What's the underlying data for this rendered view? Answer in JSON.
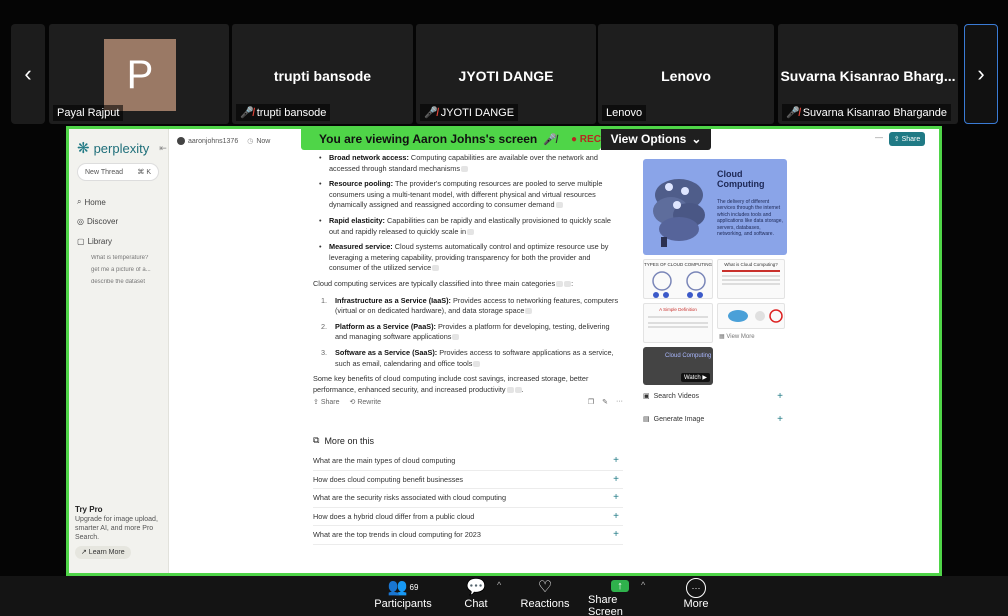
{
  "participants": [
    {
      "name": "Payal Rajput",
      "initial": "P",
      "label": "Payal Rajput",
      "muted": false
    },
    {
      "name": "trupti bansode",
      "label": "trupti bansode",
      "muted": true
    },
    {
      "name": "JYOTI DANGE",
      "label": "JYOTI DANGE",
      "muted": true
    },
    {
      "name": "Lenovo",
      "label": "Lenovo",
      "muted": false
    },
    {
      "name": "Suvarna Kisanrao Bharg...",
      "label": "Suvarna Kisanrao Bhargande",
      "muted": true
    }
  ],
  "nav": {
    "prev": "‹",
    "next": "›"
  },
  "share_banner": {
    "text": "You are viewing  Aaron Johns's screen",
    "rec": "REC",
    "view_options": "View Options"
  },
  "perplexity": {
    "logo": "perplexity",
    "new_thread": "New Thread",
    "shortcut": "⌘ K",
    "nav": [
      "Home",
      "Discover",
      "Library"
    ],
    "library_items": [
      "What is temperature?",
      "get me a picture of a...",
      "describe the dataset"
    ],
    "try_pro": {
      "title": "Try Pro",
      "text": "Upgrade for image upload, smarter AI, and more Pro Search.",
      "button": "↗ Learn More"
    },
    "top": {
      "user": "aaronjohns1376",
      "time": "Now",
      "share": "Share",
      "dash": "—"
    }
  },
  "answer": {
    "bullets": [
      {
        "bold": "Broad network access:",
        "text": " Computing capabilities are available over the network and accessed through standard mechanisms"
      },
      {
        "bold": "Resource pooling:",
        "text": " The provider's computing resources are pooled to serve multiple consumers using a multi-tenant model, with different physical and virtual resources dynamically assigned and reassigned according to consumer demand"
      },
      {
        "bold": "Rapid elasticity:",
        "text": " Capabilities can be rapidly and elastically provisioned to quickly scale out and rapidly released to quickly scale in"
      },
      {
        "bold": "Measured service:",
        "text": " Cloud systems automatically control and optimize resource use by leveraging a metering capability, providing transparency for both the provider and consumer of the utilized service"
      }
    ],
    "intro": "Cloud computing services are typically classified into three main categories",
    "numbered": [
      {
        "n": "1.",
        "bold": "Infrastructure as a Service (IaaS):",
        "text": " Provides access to networking features, computers (virtual or on dedicated hardware), and data storage space"
      },
      {
        "n": "2.",
        "bold": "Platform as a Service (PaaS):",
        "text": " Provides a platform for developing, testing, delivering and managing software applications"
      },
      {
        "n": "3.",
        "bold": "Software as a Service (SaaS):",
        "text": " Provides access to software applications as a service, such as email, calendaring and office tools"
      }
    ],
    "closing": "Some key benefits of cloud computing include cost savings, increased storage, better performance, enhanced security, and increased productivity",
    "actions": {
      "share": "Share",
      "rewrite": "Rewrite",
      "more": "···"
    }
  },
  "more_on_this": {
    "heading": "More on this",
    "items": [
      "What are the main types of cloud computing",
      "How does cloud computing benefit businesses",
      "What are the security risks associated with cloud computing",
      "How does a hybrid cloud differ from a public cloud",
      "What are the top trends in cloud computing for 2023"
    ]
  },
  "right_panel": {
    "card_title": "Cloud Computing",
    "card_sub": "The delivery of different services through the internet which includes tools and applications like data storage, servers, databases, networking, and software.",
    "thumb1": "TYPES OF CLOUD COMPUTING",
    "thumb2": "What is Cloud Computing?",
    "thumb3": "A Simple Definition",
    "view_more": "View More",
    "video_title": "Cloud Computing",
    "watch": "Watch ▶",
    "search_videos": "Search Videos",
    "generate_image": "Generate Image"
  },
  "toolbar": {
    "participants": "Participants",
    "participant_count": "69",
    "chat": "Chat",
    "reactions": "Reactions",
    "share_screen": "Share Screen",
    "more": "More"
  },
  "colors": {
    "accent_green": "#4fd548",
    "perplexity_teal": "#207a85",
    "mic_off": "#e0463a"
  }
}
